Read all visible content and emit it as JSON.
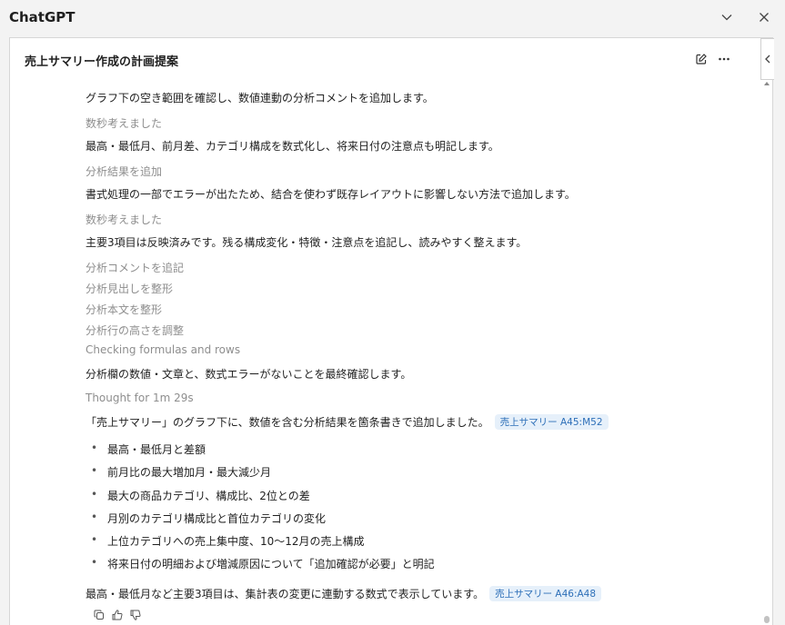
{
  "app": {
    "title": "ChatGPT"
  },
  "conversation": {
    "title": "売上サマリー作成の計画提案"
  },
  "steps": [
    {
      "kind": "main",
      "text": "グラフ下の空き範囲を確認し、数値連動の分析コメントを追加します。"
    },
    {
      "kind": "gray",
      "text": "数秒考えました"
    },
    {
      "kind": "main",
      "text": "最高・最低月、前月差、カテゴリ構成を数式化し、将来日付の注意点も明記します。"
    },
    {
      "kind": "gray",
      "text": "分析結果を追加"
    },
    {
      "kind": "main",
      "text": "書式処理の一部でエラーが出たため、結合を使わず既存レイアウトに影響しない方法で追加します。"
    },
    {
      "kind": "gray",
      "text": "数秒考えました"
    },
    {
      "kind": "main",
      "text": "主要3項目は反映済みです。残る構成変化・特徴・注意点を追記し、読みやすく整えます。"
    },
    {
      "kind": "gray",
      "text": "分析コメントを追記"
    },
    {
      "kind": "gray",
      "text": "分析見出しを整形"
    },
    {
      "kind": "gray",
      "text": "分析本文を整形"
    },
    {
      "kind": "gray",
      "text": "分析行の高さを調整"
    },
    {
      "kind": "gray",
      "text": "Checking formulas and rows"
    },
    {
      "kind": "main",
      "text": "分析欄の数値・文章と、数式エラーがないことを最終確認します。"
    },
    {
      "kind": "gray",
      "text": "Thought for 1m 29s"
    }
  ],
  "summary": {
    "text": "「売上サマリー」のグラフ下に、数値を含む分析結果を箇条書きで追加しました。",
    "chip": "売上サマリー A45:M52"
  },
  "bullets": [
    "最高・最低月と差額",
    "前月比の最大増加月・最大減少月",
    "最大の商品カテゴリ、構成比、2位との差",
    "月別のカテゴリ構成比と首位カテゴリの変化",
    "上位カテゴリへの売上集中度、10〜12月の売上構成",
    "将来日付の明細および増減原因について「追加確認が必要」と明記"
  ],
  "footer": {
    "text": "最高・最低月など主要3項目は、集計表の変更に連動する数式で表示しています。",
    "chip": "売上サマリー A46:A48"
  },
  "icons": {
    "minimize": "chevron-down-icon",
    "close": "close-icon",
    "edit": "compose-icon",
    "more": "more-dots-icon",
    "sidebar": "chevron-left-icon",
    "copy": "copy-icon",
    "like": "thumbs-up-icon",
    "dislike": "thumbs-down-icon"
  },
  "colors": {
    "chip_bg": "#e6f0fa",
    "chip_text": "#2d6fb8",
    "muted_text": "#8e8e8e"
  }
}
